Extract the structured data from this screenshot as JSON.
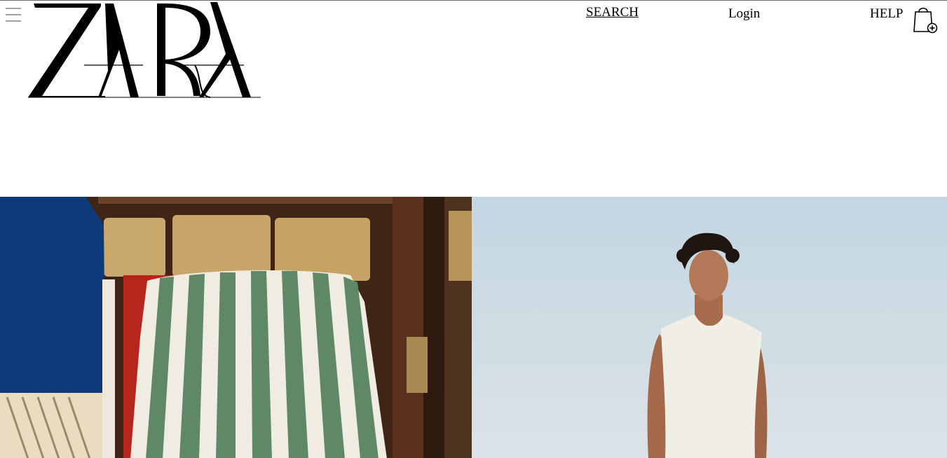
{
  "header": {
    "logo_text": "ZARA",
    "menu_icon": "hamburger-icon",
    "nav": {
      "search_label": "SEARCH",
      "login_label": "Login",
      "help_label": "HELP"
    },
    "bag_icon": "shopping-bag-icon"
  },
  "hero": {
    "left_image": "still-life-striped-towel-on-chair",
    "right_image": "model-white-tank-top-sky"
  },
  "colors": {
    "text": "#000000",
    "background": "#ffffff",
    "sky": "#c6d7e0",
    "wood": "#4a2d1c",
    "stripe_green": "#5f8a66",
    "royal_blue": "#123c7c",
    "chair_red": "#b8281e"
  }
}
